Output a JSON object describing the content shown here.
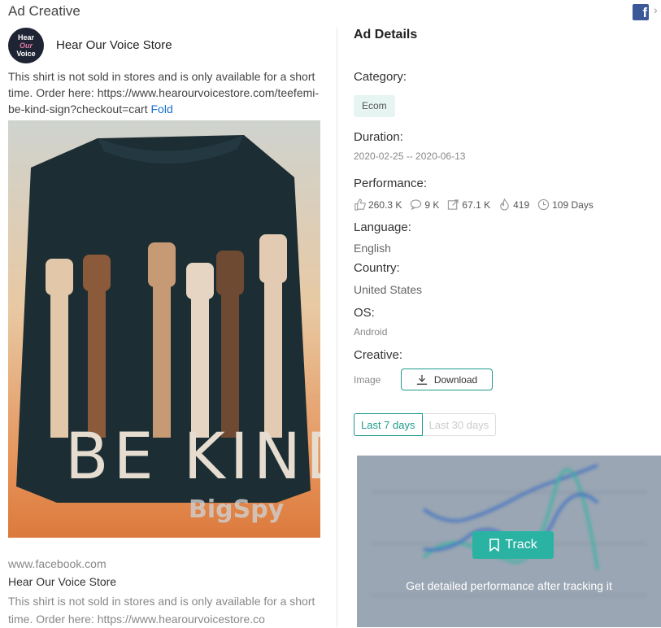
{
  "header": {
    "title": "Ad Creative"
  },
  "advertiser": {
    "avatar_text": [
      "Hear",
      "Our",
      "Voice"
    ],
    "name": "Hear Our Voice Store"
  },
  "ad": {
    "text": "This shirt is not sold in stores and is only available for a short time. Order here: https://www.hearourvoicestore.com/teefemi-be-kind-sign?checkout=cart",
    "fold_label": "Fold",
    "image": {
      "shirt_text": "BE KIND",
      "watermark": "BigSpy"
    },
    "link": "www.facebook.com",
    "bottom_name": "Hear Our Voice Store",
    "bottom_text": "This shirt is not sold in stores and is only available for a short time. Order here: https://www.hearourvoicestore.co"
  },
  "details": {
    "title": "Ad Details",
    "category_label": "Category:",
    "category_value": "Ecom",
    "duration_label": "Duration:",
    "duration_value": "2020-02-25 -- 2020-06-13",
    "performance_label": "Performance:",
    "performance": {
      "likes": "260.3 K",
      "comments": "9 K",
      "shares": "67.1 K",
      "hot": "419",
      "days": "109 Days"
    },
    "language_label": "Language:",
    "language_value": "English",
    "country_label": "Country:",
    "country_value": "United States",
    "os_label": "OS:",
    "os_value": "Android",
    "creative_label": "Creative:",
    "creative_value": "Image",
    "download_label": "Download"
  },
  "tabs": {
    "active": "Last 7 days",
    "inactive": "Last 30 days"
  },
  "track": {
    "button_label": "Track",
    "note": "Get detailed performance after tracking it"
  },
  "colors": {
    "accent": "#1f9a8c",
    "track_button": "#2ab3a3",
    "link": "#1a6fcf",
    "facebook": "#3b5998"
  }
}
